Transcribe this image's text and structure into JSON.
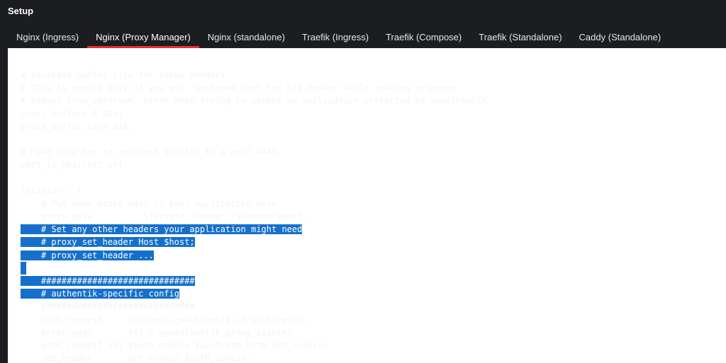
{
  "header": {
    "title": "Setup"
  },
  "tabs": [
    {
      "label": "Nginx (Ingress)",
      "active": false
    },
    {
      "label": "Nginx (Proxy Manager)",
      "active": true
    },
    {
      "label": "Nginx (standalone)",
      "active": false
    },
    {
      "label": "Traefik (Ingress)",
      "active": false
    },
    {
      "label": "Traefik (Compose)",
      "active": false
    },
    {
      "label": "Traefik (Standalone)",
      "active": false
    },
    {
      "label": "Caddy (Standalone)",
      "active": false
    }
  ],
  "code": {
    "selection_color": "#1570cc",
    "lines": [
      {
        "text": "# Increase buffer size for large headers",
        "selected": false
      },
      {
        "text": "# This is needed only if you get 'upstream sent too big header while reading response",
        "selected": false
      },
      {
        "text": "# header from upstream' error when trying to access an application protected by goauthentik",
        "selected": false
      },
      {
        "text": "proxy_buffers 8 16k;",
        "selected": false
      },
      {
        "text": "proxy_buffer_size 32k;",
        "selected": false
      },
      {
        "text": "",
        "selected": false
      },
      {
        "text": "# Make sure not to redirect traffic to a port 4443",
        "selected": false
      },
      {
        "text": "port_in_redirect off;",
        "selected": false
      },
      {
        "text": "",
        "selected": false
      },
      {
        "text": "location / {",
        "selected": false
      },
      {
        "text": "    # Put your proxy_pass to your application here",
        "selected": false
      },
      {
        "text": "    proxy_pass          $forward_scheme://$server:$port;",
        "selected": false
      },
      {
        "text": "    # Set any other headers your application might need",
        "selected": true
      },
      {
        "text": "    # proxy_set_header Host $host;",
        "selected": true
      },
      {
        "text": "    # proxy_set_header ...",
        "selected": true
      },
      {
        "text": "",
        "selected": true
      },
      {
        "text": "    ##############################",
        "selected": true
      },
      {
        "text": "    # authentik-specific config",
        "selected": true
      },
      {
        "text": "    ##############################",
        "selected": false
      },
      {
        "text": "    auth_request     /outpost.goauthentik.io/auth/nginx;",
        "selected": false
      },
      {
        "text": "    error_page       401 = @goauthentik_proxy_signin;",
        "selected": false
      },
      {
        "text": "    auth_request_set $auth_cookie $upstream_http_set_cookie;",
        "selected": false
      },
      {
        "text": "    add_header       Set-Cookie $auth_cookie;",
        "selected": false
      }
    ]
  }
}
